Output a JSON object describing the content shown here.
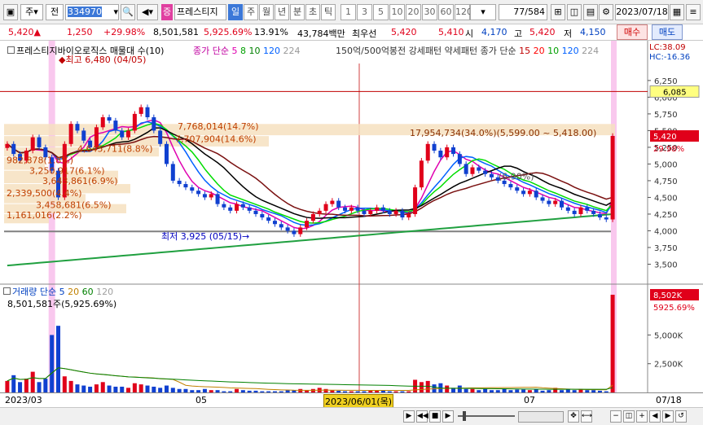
{
  "toolbar": {
    "mode_label": "주",
    "period_label": "전",
    "code_value": "334970",
    "name_tag": "증",
    "stock_name": "프레스티지",
    "tf_items": [
      "일",
      "주",
      "월",
      "년",
      "분",
      "초",
      "틱"
    ],
    "tf_active_index": 0,
    "num_items": [
      "1",
      "3",
      "5",
      "10",
      "20",
      "30",
      "60",
      "120"
    ],
    "count_value": "77",
    "count_total": "/584",
    "date_value": "2023/07/18"
  },
  "info": {
    "price": "5,420",
    "arrow": "▲",
    "change": "1,250",
    "change_pct": "+29.98%",
    "volume": "8,501,581",
    "vol_pct": "5,925.69%",
    "turnover": "13.91%",
    "amount": "43,784백만",
    "best_ask_label": "최우선",
    "ask": "5,420",
    "bid": "5,410",
    "open_label": "시",
    "open": "4,170",
    "high_label": "고",
    "high": "5,420",
    "low_label": "저",
    "low": "4,150",
    "buy_label": "매수",
    "sell_label": "매도"
  },
  "legend": {
    "stock_title": "프레스티지바이오로직스 매물대 수(10)",
    "ma_title": "종가 단순",
    "ma_periods": [
      "5",
      "8",
      "10",
      "120",
      "224"
    ],
    "ma_colors": [
      "#e000b0",
      "#00a000",
      "#008000",
      "#0060ff",
      "#999999"
    ],
    "pattern1": "150억/500억봉전",
    "pattern2": "강세패턴",
    "pattern3": "약세패턴",
    "ma2_title": "종가 단순",
    "ma2_periods": [
      "15",
      "20",
      "10",
      "120",
      "224"
    ],
    "ma2_colors": [
      "#c00000",
      "#ff0000",
      "#00a000",
      "#0060ff",
      "#999999"
    ],
    "lc": "LC:38.09",
    "hc": "HC:-16.36"
  },
  "annotations": {
    "high": "최고 6,480 (04/05)",
    "low": "최저 3,925 (05/15)",
    "vp_top": "7,768,014(14.7%)",
    "vp_2": "7,707,904(14.6%)",
    "vp_3": "4,645,711(8.8%)",
    "vp_4": "982,878(1.8%)",
    "vp_5": "3,250,917(6.1%)",
    "vp_6": "3,643,861(6.9%)",
    "vp_7": "2,339,500(4.4%)",
    "vp_8": "3,458,681(6.5%)",
    "vp_9": "1,161,016(2.2%)",
    "vp_now": "17,954,734(34.0%)(5,599.00 ~ 5,418.00)",
    "mid_note": "(6.90%)"
  },
  "price_axis": {
    "ticks": [
      "6,250",
      "6,000",
      "5,750",
      "5,500",
      "5,250",
      "5,000",
      "4,750",
      "4,500",
      "4,250",
      "4,000",
      "3,750",
      "3,500"
    ],
    "line_label": "6,085",
    "current_label": "5,420",
    "current_pct": "29.98%"
  },
  "volume_panel": {
    "title": "거래량 단순",
    "periods": [
      "5",
      "20",
      "60",
      "120"
    ],
    "period_colors": [
      "#0040c0",
      "#c08000",
      "#008000",
      "#a0a0a0"
    ],
    "value_text": "8,501,581주(5,925.69%)",
    "ticks": [
      "5,000K",
      "2,500K"
    ],
    "current_label": "8,502K",
    "current_pct": "5925.69%"
  },
  "xaxis": {
    "labels": [
      "2023/03",
      "05",
      "07"
    ],
    "cursor_label": "2023/06/01(목)",
    "right_label": "07/18"
  },
  "chart_data": {
    "type": "candlestick",
    "ylim": [
      3250,
      6480
    ],
    "price_ticks": [
      6250,
      6000,
      5750,
      5500,
      5250,
      5000,
      4750,
      4500,
      4250,
      4000,
      3750,
      3500
    ],
    "closes": [
      5300,
      5150,
      5050,
      5200,
      5400,
      5250,
      5100,
      4900,
      4500,
      5300,
      5600,
      5500,
      5350,
      5250,
      5550,
      5700,
      5650,
      5500,
      5400,
      5500,
      5750,
      5850,
      5700,
      5500,
      5300,
      5000,
      4750,
      4700,
      4650,
      4600,
      4550,
      4500,
      4550,
      4400,
      4350,
      4300,
      4400,
      4350,
      4300,
      4250,
      4200,
      4150,
      4100,
      4050,
      4000,
      3950,
      4050,
      4150,
      4250,
      4300,
      4400,
      4450,
      4350,
      4300,
      4350,
      4300,
      4250,
      4300,
      4350,
      4300,
      4250,
      4300,
      4200,
      4250,
      4650,
      5050,
      5300,
      5200,
      5100,
      5250,
      5150,
      5000,
      4850,
      4950,
      4900,
      4850,
      4800,
      4750,
      4700,
      4650,
      4600,
      4550,
      4600,
      4500,
      4450,
      4400,
      4450,
      4350,
      4300,
      4250,
      4350,
      4300,
      4250,
      4200,
      4170,
      5420
    ],
    "volumes_k": [
      1000,
      1500,
      900,
      1200,
      1800,
      900,
      1200,
      5000,
      5800,
      1400,
      1000,
      700,
      600,
      500,
      700,
      900,
      600,
      500,
      500,
      400,
      800,
      700,
      600,
      500,
      400,
      600,
      400,
      300,
      300,
      200,
      200,
      300,
      200,
      200,
      100,
      100,
      300,
      200,
      150,
      150,
      100,
      100,
      100,
      100,
      200,
      200,
      300,
      200,
      300,
      400,
      300,
      200,
      150,
      100,
      100,
      100,
      100,
      150,
      200,
      150,
      100,
      100,
      100,
      100,
      1100,
      900,
      1000,
      700,
      800,
      600,
      400,
      600,
      300,
      300,
      200,
      300,
      200,
      200,
      300,
      200,
      250,
      250,
      200,
      300,
      150,
      200,
      400,
      200,
      300,
      200,
      300,
      200,
      200,
      150,
      100,
      8502
    ],
    "vlim": [
      0,
      9000
    ]
  }
}
